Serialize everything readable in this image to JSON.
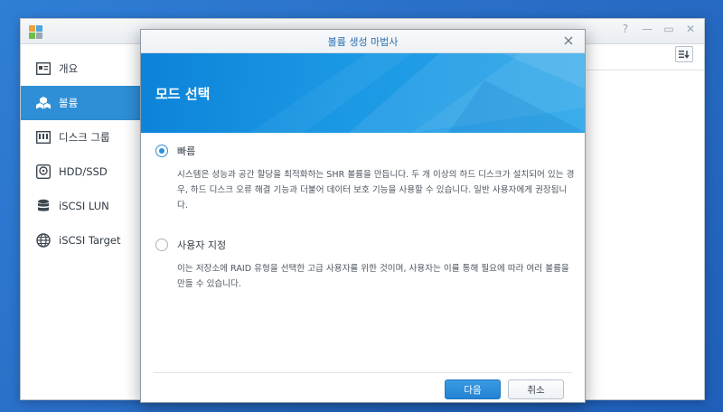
{
  "main_window": {
    "sidebar": [
      {
        "label": "개요",
        "icon": "overview-icon"
      },
      {
        "label": "볼륨",
        "icon": "volume-icon",
        "active": true
      },
      {
        "label": "디스크 그룹",
        "icon": "disk-group-icon"
      },
      {
        "label": "HDD/SSD",
        "icon": "hdd-icon"
      },
      {
        "label": "iSCSI LUN",
        "icon": "lun-icon"
      },
      {
        "label": "iSCSI Target",
        "icon": "target-icon"
      }
    ],
    "window_controls": [
      "?",
      "—",
      "▭",
      "✕"
    ]
  },
  "dialog": {
    "title": "볼륨 생성 마법사",
    "banner_title": "모드 선택",
    "options": [
      {
        "label": "빠름",
        "checked": true,
        "description": "시스템은 성능과 공간 할당을 최적화하는 SHR 볼륨을 만듭니다. 두 개 이상의 하드 디스크가 설치되어 있는 경우, 하드 디스크 오류 해결 기능과 더불어 데이터 보호 기능을 사용할 수 있습니다. 일반 사용자에게 권장됩니다."
      },
      {
        "label": "사용자 지정",
        "checked": false,
        "description": "이는 저장소에 RAID 유형을 선택한 고급 사용자를 위한 것이며, 사용자는 이를 통해 필요에 따라 여러 볼륨을 만들 수 있습니다."
      }
    ],
    "buttons": {
      "next": "다음",
      "cancel": "취소"
    }
  },
  "colors": {
    "accent": "#2e8fd7",
    "desktop": "#2a6fc8"
  }
}
